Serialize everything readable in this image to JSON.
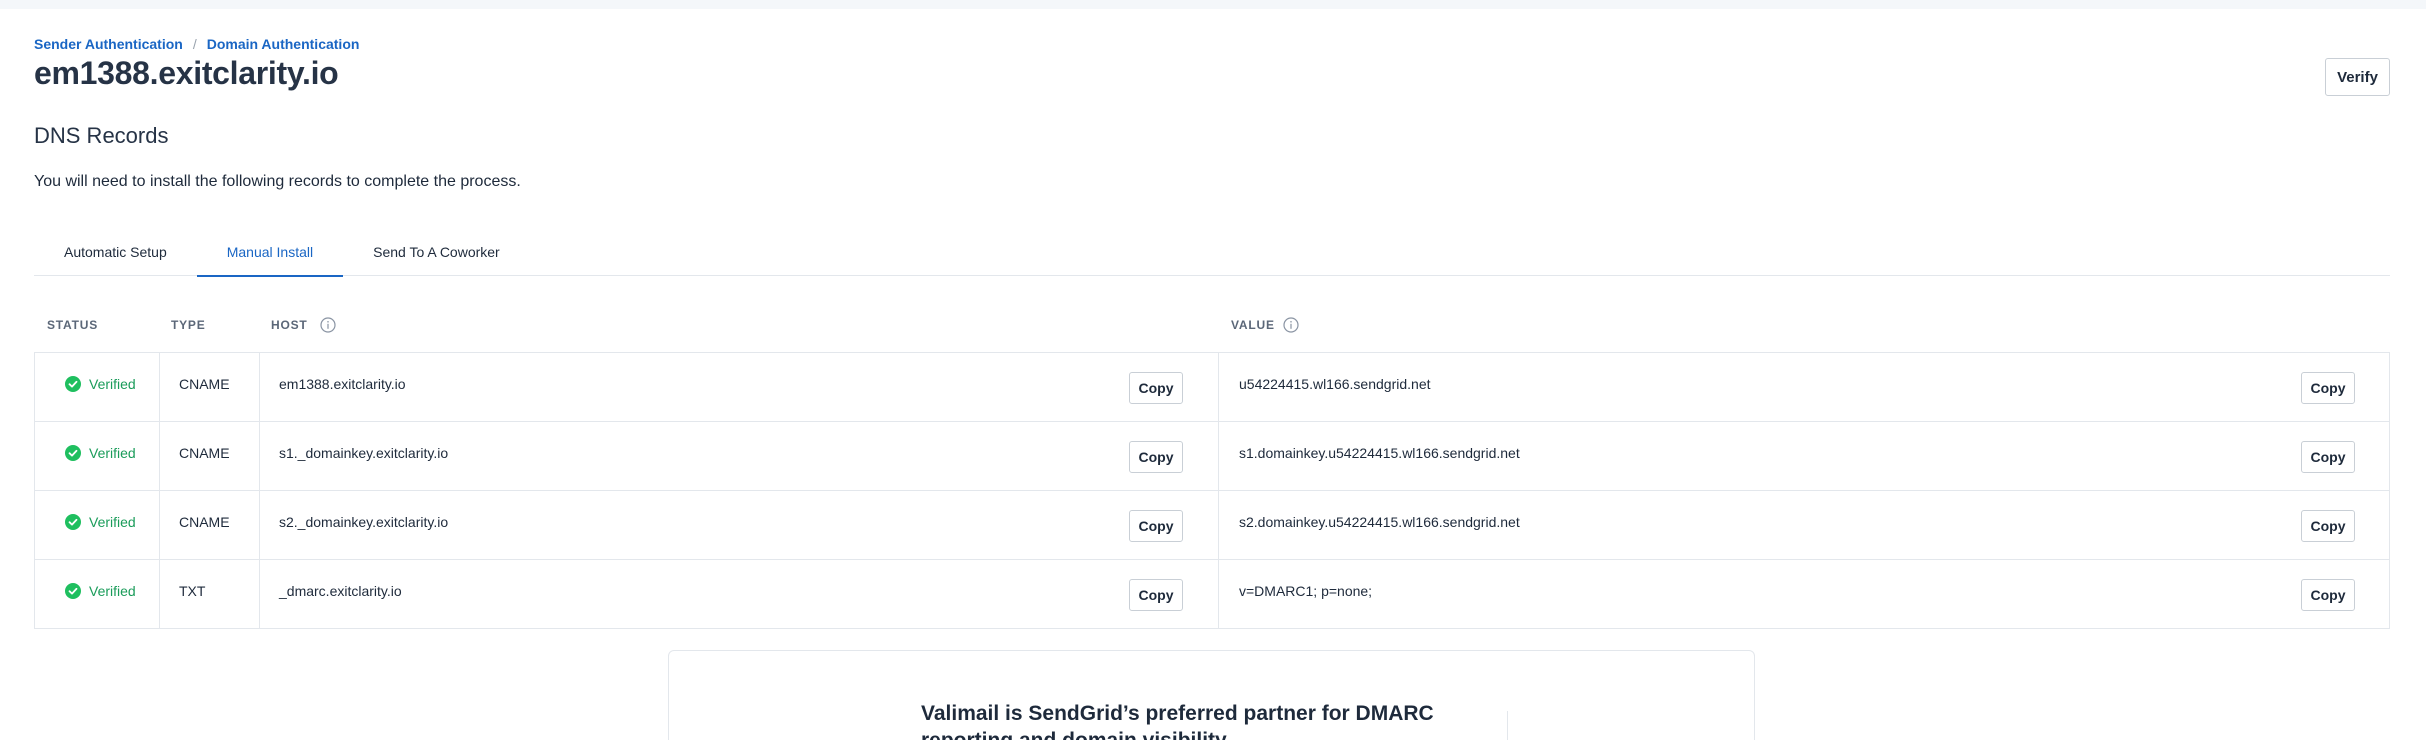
{
  "breadcrumb": {
    "items": [
      "Sender Authentication",
      "Domain Authentication"
    ],
    "separator": "/"
  },
  "page_title": "em1388.exitclarity.io",
  "verify_label": "Verify",
  "section_title": "DNS Records",
  "intro_text": "You will need to install the following records to complete the process.",
  "tabs": [
    {
      "label": "Automatic Setup",
      "active": false
    },
    {
      "label": "Manual Install",
      "active": true
    },
    {
      "label": "Send To A Coworker",
      "active": false
    }
  ],
  "table": {
    "headers": {
      "status": "STATUS",
      "type": "TYPE",
      "host": "HOST",
      "value": "VALUE"
    },
    "copy_label": "Copy",
    "rows": [
      {
        "status": "Verified",
        "type": "CNAME",
        "host": "em1388.exitclarity.io",
        "value": "u54224415.wl166.sendgrid.net"
      },
      {
        "status": "Verified",
        "type": "CNAME",
        "host": "s1._domainkey.exitclarity.io",
        "value": "s1.domainkey.u54224415.wl166.sendgrid.net"
      },
      {
        "status": "Verified",
        "type": "CNAME",
        "host": "s2._domainkey.exitclarity.io",
        "value": "s2.domainkey.u54224415.wl166.sendgrid.net"
      },
      {
        "status": "Verified",
        "type": "TXT",
        "host": "_dmarc.exitclarity.io",
        "value": "v=DMARC1; p=none;"
      }
    ]
  },
  "promo": {
    "title": "Valimail is SendGrid’s preferred partner for DMARC reporting and domain visibility"
  },
  "colors": {
    "accent": "#1a66c4",
    "verified": "#1a9c5a",
    "border": "#e3e7ec"
  },
  "icons": {
    "info": "info-icon",
    "status_check": "check-circle-icon"
  }
}
